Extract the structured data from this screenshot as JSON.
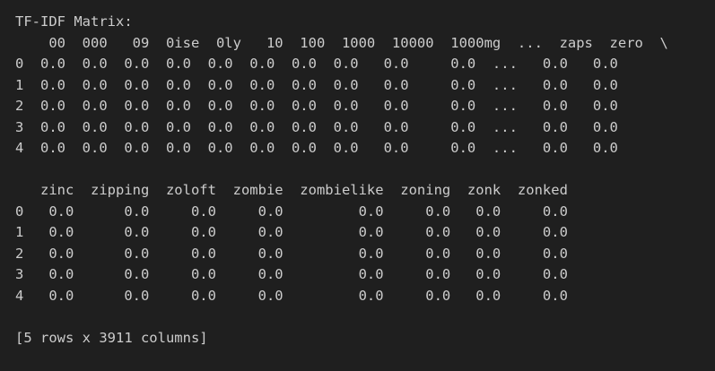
{
  "output": {
    "title": "TF-IDF Matrix:",
    "table1": {
      "header": "    00  000   09  0ise  0ly   10  100  1000  10000  1000mg  ...  zaps  zero  \\",
      "rows": [
        "0  0.0  0.0  0.0  0.0  0.0  0.0  0.0  0.0   0.0     0.0  ...   0.0   0.0",
        "1  0.0  0.0  0.0  0.0  0.0  0.0  0.0  0.0   0.0     0.0  ...   0.0   0.0",
        "2  0.0  0.0  0.0  0.0  0.0  0.0  0.0  0.0   0.0     0.0  ...   0.0   0.0",
        "3  0.0  0.0  0.0  0.0  0.0  0.0  0.0  0.0   0.0     0.0  ...   0.0   0.0",
        "4  0.0  0.0  0.0  0.0  0.0  0.0  0.0  0.0   0.0     0.0  ...   0.0   0.0"
      ]
    },
    "table2": {
      "header": "   zinc  zipping  zoloft  zombie  zombielike  zoning  zonk  zonked",
      "rows": [
        "0   0.0      0.0     0.0     0.0         0.0     0.0   0.0     0.0",
        "1   0.0      0.0     0.0     0.0         0.0     0.0   0.0     0.0",
        "2   0.0      0.0     0.0     0.0         0.0     0.0   0.0     0.0",
        "3   0.0      0.0     0.0     0.0         0.0     0.0   0.0     0.0",
        "4   0.0      0.0     0.0     0.0         0.0     0.0   0.0     0.0"
      ]
    },
    "summary": "[5 rows x 3911 columns]"
  }
}
